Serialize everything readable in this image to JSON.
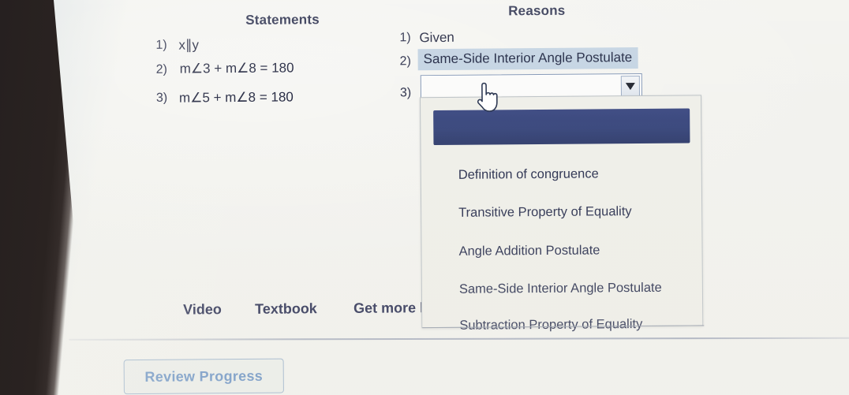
{
  "proof": {
    "headers": {
      "statements": "Statements",
      "reasons": "Reasons"
    },
    "statements": [
      {
        "num": "1)",
        "text": "x∥y"
      },
      {
        "num": "2)",
        "text": "m∠3 + m∠8 = 180"
      },
      {
        "num": "3)",
        "text": "m∠5 + m∠8 = 180"
      }
    ],
    "reasons": [
      {
        "num": "1)",
        "text": "Given",
        "state": "static"
      },
      {
        "num": "2)",
        "text": "Same-Side Interior Angle Postulate",
        "state": "filled"
      },
      {
        "num": "3)",
        "text": "",
        "state": "select-open"
      }
    ]
  },
  "select": {
    "value": "",
    "placeholder": "",
    "arrow_icon": "chevron-down-icon"
  },
  "dropdown": {
    "highlighted_index": 0,
    "options": [
      "",
      "Definition of congruence",
      "Transitive Property of Equality",
      "Angle Addition Postulate",
      "Same-Side Interior Angle Postulate",
      "Subtraction Property of Equality"
    ]
  },
  "resources": {
    "video": "Video",
    "textbook": "Textbook",
    "get_more_help": "Get more h"
  },
  "footer": {
    "review_progress": "Review Progress"
  },
  "cursor": {
    "icon": "pointing-hand-cursor"
  },
  "colors": {
    "page_background": "#f1f2ee",
    "heading_text": "#2e3350",
    "body_text": "#22263f",
    "filled_reason_highlight": "#c3d3e2",
    "dropdown_selected": "#3c4a7e",
    "dropdown_background": "#efefe9",
    "review_button_text": "#6b93c4",
    "review_button_border": "#9db4cc",
    "select_border": "#8296b4"
  }
}
